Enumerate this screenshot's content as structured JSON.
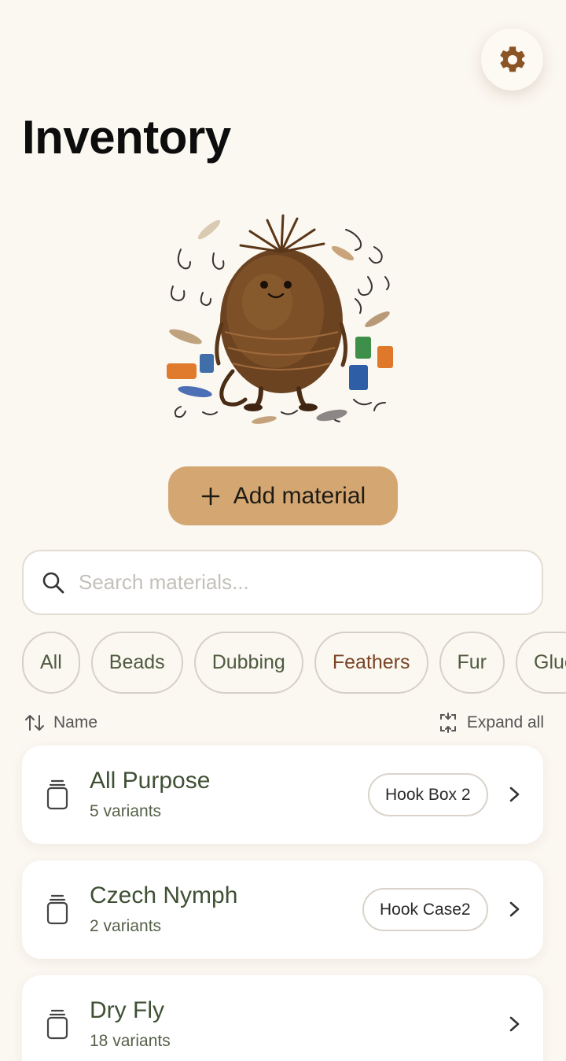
{
  "header": {
    "title": "Inventory",
    "settings_icon": "gear-icon"
  },
  "add_button": {
    "label": "Add material",
    "icon": "plus-icon"
  },
  "search": {
    "placeholder": "Search materials...",
    "value": ""
  },
  "filters": {
    "chips": [
      "All",
      "Beads",
      "Dubbing",
      "Feathers",
      "Fur",
      "Glue"
    ]
  },
  "sort": {
    "label": "Name",
    "expand_label": "Expand all"
  },
  "materials": [
    {
      "name": "All Purpose",
      "variants": "5 variants",
      "location": "Hook Box 2"
    },
    {
      "name": "Czech Nymph",
      "variants": "2 variants",
      "location": "Hook Case2"
    },
    {
      "name": "Dry Fly",
      "variants": "18 variants",
      "location": ""
    }
  ],
  "colors": {
    "accent": "#d4a772",
    "background": "#fbf7f1",
    "settings_icon": "#8a5424",
    "text_green": "#3f5034",
    "chip_active": "#7a4425"
  }
}
